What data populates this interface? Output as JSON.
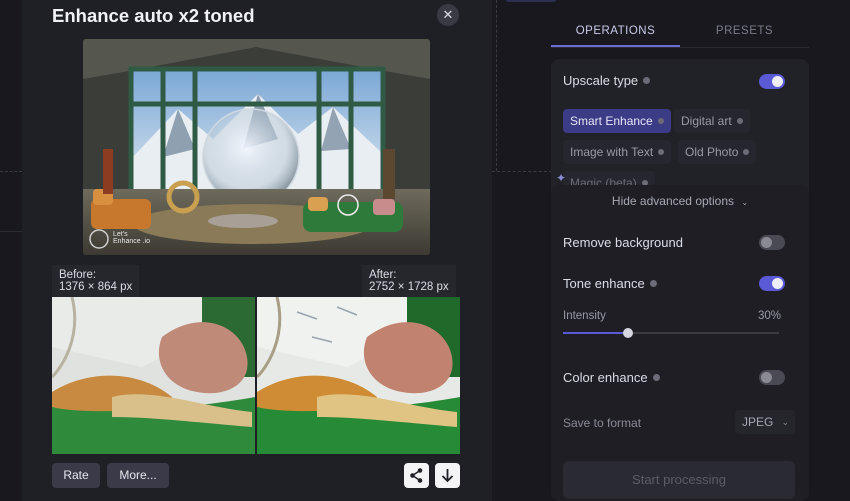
{
  "modal": {
    "title": "Enhance auto x2 toned",
    "close_icon": "close-icon",
    "preview_watermark": "Let's Enhance .io",
    "before_label": "Before:",
    "before_size": "1376 × 864 px",
    "after_label": "After:",
    "after_size": "2752 × 1728 px",
    "rate_label": "Rate",
    "more_label": "More...",
    "share_icon": "share-icon",
    "download_icon": "download-icon"
  },
  "panel": {
    "tabs": [
      {
        "label": "OPERATIONS",
        "active": true
      },
      {
        "label": "PRESETS",
        "active": false
      }
    ],
    "upscale_type": {
      "label": "Upscale type",
      "enabled": true
    },
    "chips": [
      {
        "label": "Smart Enhance",
        "active": true
      },
      {
        "label": "Digital art",
        "active": false
      },
      {
        "label": "Image with Text",
        "active": false
      },
      {
        "label": "Old Photo",
        "active": false
      },
      {
        "label": "Magic (beta)",
        "active": false
      }
    ],
    "hide_advanced": "Hide advanced options",
    "remove_background": {
      "label": "Remove background",
      "enabled": false
    },
    "tone_enhance": {
      "label": "Tone enhance",
      "enabled": true
    },
    "intensity": {
      "label": "Intensity",
      "value_text": "30%",
      "value": 0.3
    },
    "color_enhance": {
      "label": "Color enhance",
      "enabled": false
    },
    "save_format": {
      "label": "Save to format",
      "value": "JPEG"
    },
    "start_button": "Start processing"
  },
  "colors": {
    "accent": "#5a5ad6",
    "active_chip": "#3b3b86",
    "modal_bg": "#1f1f26"
  }
}
